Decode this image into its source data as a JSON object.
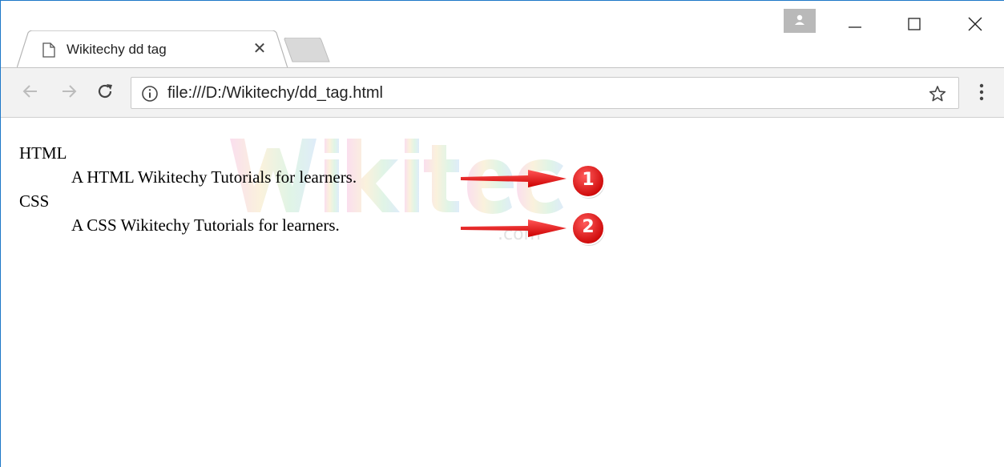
{
  "browser": {
    "tab_title": "Wikitechy dd tag",
    "tab_close_glyph": "✕",
    "url": "file:///D:/Wikitechy/dd_tag.html",
    "icons": {
      "page": "page-icon",
      "back": "back-arrow-icon",
      "forward": "forward-arrow-icon",
      "reload": "reload-icon",
      "info": "info-icon",
      "star": "bookmark-star-icon",
      "menu": "kebab-menu-icon",
      "profile": "profile-icon"
    }
  },
  "page": {
    "definitions": [
      {
        "term": "HTML",
        "description": "A HTML Wikitechy Tutorials for learners."
      },
      {
        "term": "CSS",
        "description": "A CSS Wikitechy Tutorials for learners."
      }
    ],
    "annotations": [
      {
        "number": "1"
      },
      {
        "number": "2"
      }
    ]
  },
  "colors": {
    "arrow_red": "#ee1111",
    "badge_red": "#e30b0b",
    "window_border": "#1e78c8"
  }
}
